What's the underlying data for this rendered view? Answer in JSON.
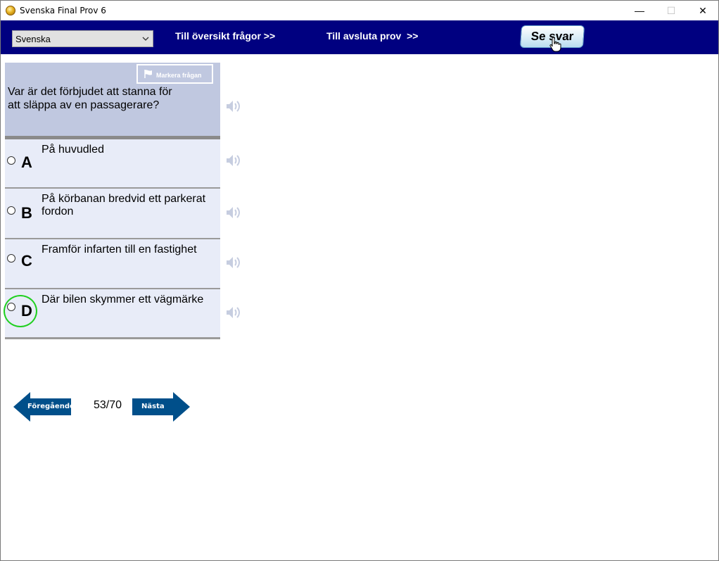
{
  "window": {
    "title": "Svenska Final Prov 6",
    "minimize_glyph": "—",
    "maximize_glyph": "☐",
    "close_glyph": "✕"
  },
  "navbar": {
    "language": "Svenska",
    "overview_link": "Till översikt frågor >>",
    "finish_link": "Till avsluta prov  >>",
    "answer_button": "Se svar"
  },
  "question": {
    "mark_button": "Markera frågan",
    "text": "Var är det förbjudet att stanna för att släppa av en passagerare?"
  },
  "options": [
    {
      "letter": "A",
      "text": "På huvudled"
    },
    {
      "letter": "B",
      "text": "På körbanan bredvid ett parkerat fordon"
    },
    {
      "letter": "C",
      "text": "Framför infarten till en fastighet"
    },
    {
      "letter": "D",
      "text": "Där bilen skymmer ett vägmärke"
    }
  ],
  "navigation": {
    "previous": "Föregående",
    "next": "Nästa",
    "counter": "53/70"
  },
  "icons": {
    "app": "coin-icon",
    "speaker": "speaker-icon",
    "flag": "flag-icon",
    "cursor": "hand-cursor-icon"
  },
  "colors": {
    "navbar": "#000080",
    "question_bg": "#c0c8e0",
    "option_bg": "#e8ecf8",
    "arrow": "#004f8a",
    "highlight_circle": "#20d020"
  }
}
